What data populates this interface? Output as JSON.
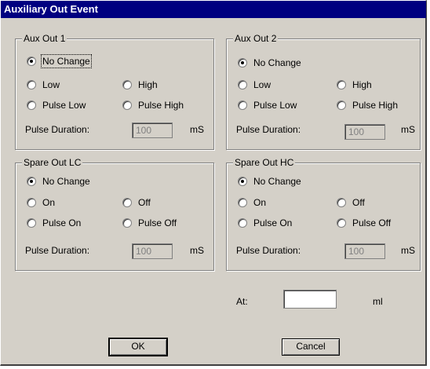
{
  "window": {
    "title": "Auxiliary Out Event"
  },
  "groups": [
    {
      "title": "Aux Out 1",
      "options": [
        "No Change",
        "Low",
        "High",
        "Pulse Low",
        "Pulse High"
      ],
      "selected": "No Change",
      "pulse_label": "Pulse Duration:",
      "pulse_value": "100",
      "pulse_unit": "mS"
    },
    {
      "title": "Aux Out 2",
      "options": [
        "No Change",
        "Low",
        "High",
        "Pulse Low",
        "Pulse High"
      ],
      "selected": "No Change",
      "pulse_label": "Pulse Duration:",
      "pulse_value": "100",
      "pulse_unit": "mS"
    },
    {
      "title": "Spare Out LC",
      "options": [
        "No Change",
        "On",
        "Off",
        "Pulse On",
        "Pulse Off"
      ],
      "selected": "No Change",
      "pulse_label": "Pulse Duration:",
      "pulse_value": "100",
      "pulse_unit": "mS"
    },
    {
      "title": "Spare Out HC",
      "options": [
        "No Change",
        "On",
        "Off",
        "Pulse On",
        "Pulse Off"
      ],
      "selected": "No Change",
      "pulse_label": "Pulse Duration:",
      "pulse_value": "100",
      "pulse_unit": "mS"
    }
  ],
  "at": {
    "label": "At:",
    "value": "",
    "unit": "ml"
  },
  "buttons": {
    "ok": "OK",
    "cancel": "Cancel"
  }
}
